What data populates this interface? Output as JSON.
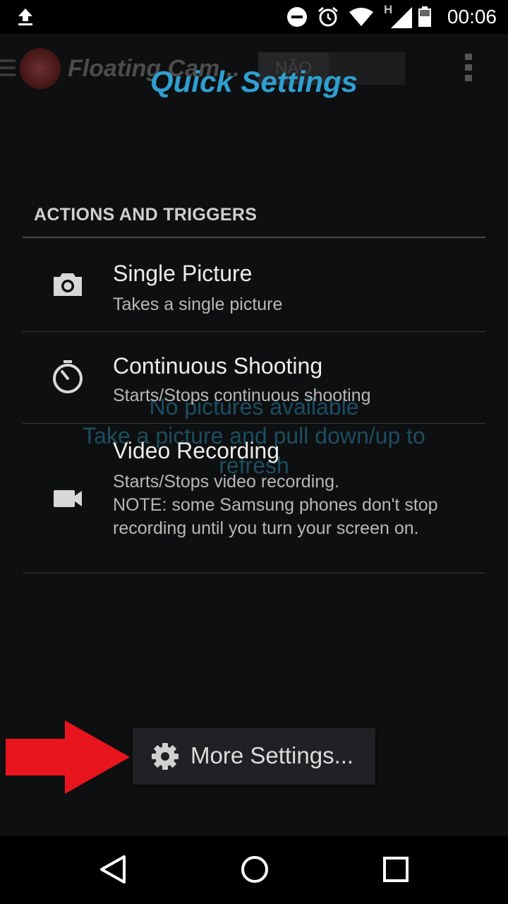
{
  "status_bar": {
    "time": "00:06",
    "network_label": "H",
    "icons": [
      "upload-icon",
      "do-not-disturb-icon",
      "alarm-icon",
      "wifi-icon",
      "signal-icon",
      "battery-icon"
    ]
  },
  "background_app": {
    "title": "Floating Cam...",
    "toggle_label": "NÃO",
    "empty_line1": "No pictures available",
    "empty_line2": "Take a picture and pull down/up to refresh"
  },
  "dialog": {
    "title": "Quick Settings",
    "section_header": "ACTIONS AND TRIGGERS",
    "items": [
      {
        "title": "Single Picture",
        "subtitle": "Takes a single picture",
        "icon": "camera-icon"
      },
      {
        "title": "Continuous Shooting",
        "subtitle": "Starts/Stops continuous shooting",
        "icon": "timer-icon"
      },
      {
        "title": "Video Recording",
        "subtitle": "Starts/Stops video recording.\nNOTE: some Samsung phones don't stop recording until you turn your screen on.",
        "icon": "video-camera-icon"
      }
    ],
    "more_settings_label": "More Settings..."
  },
  "colors": {
    "accent": "#2f9fd0",
    "arrow": "#e8141e",
    "background": "#0e0f10"
  },
  "nav": {
    "icons": [
      "back-icon",
      "home-icon",
      "recents-icon"
    ]
  }
}
